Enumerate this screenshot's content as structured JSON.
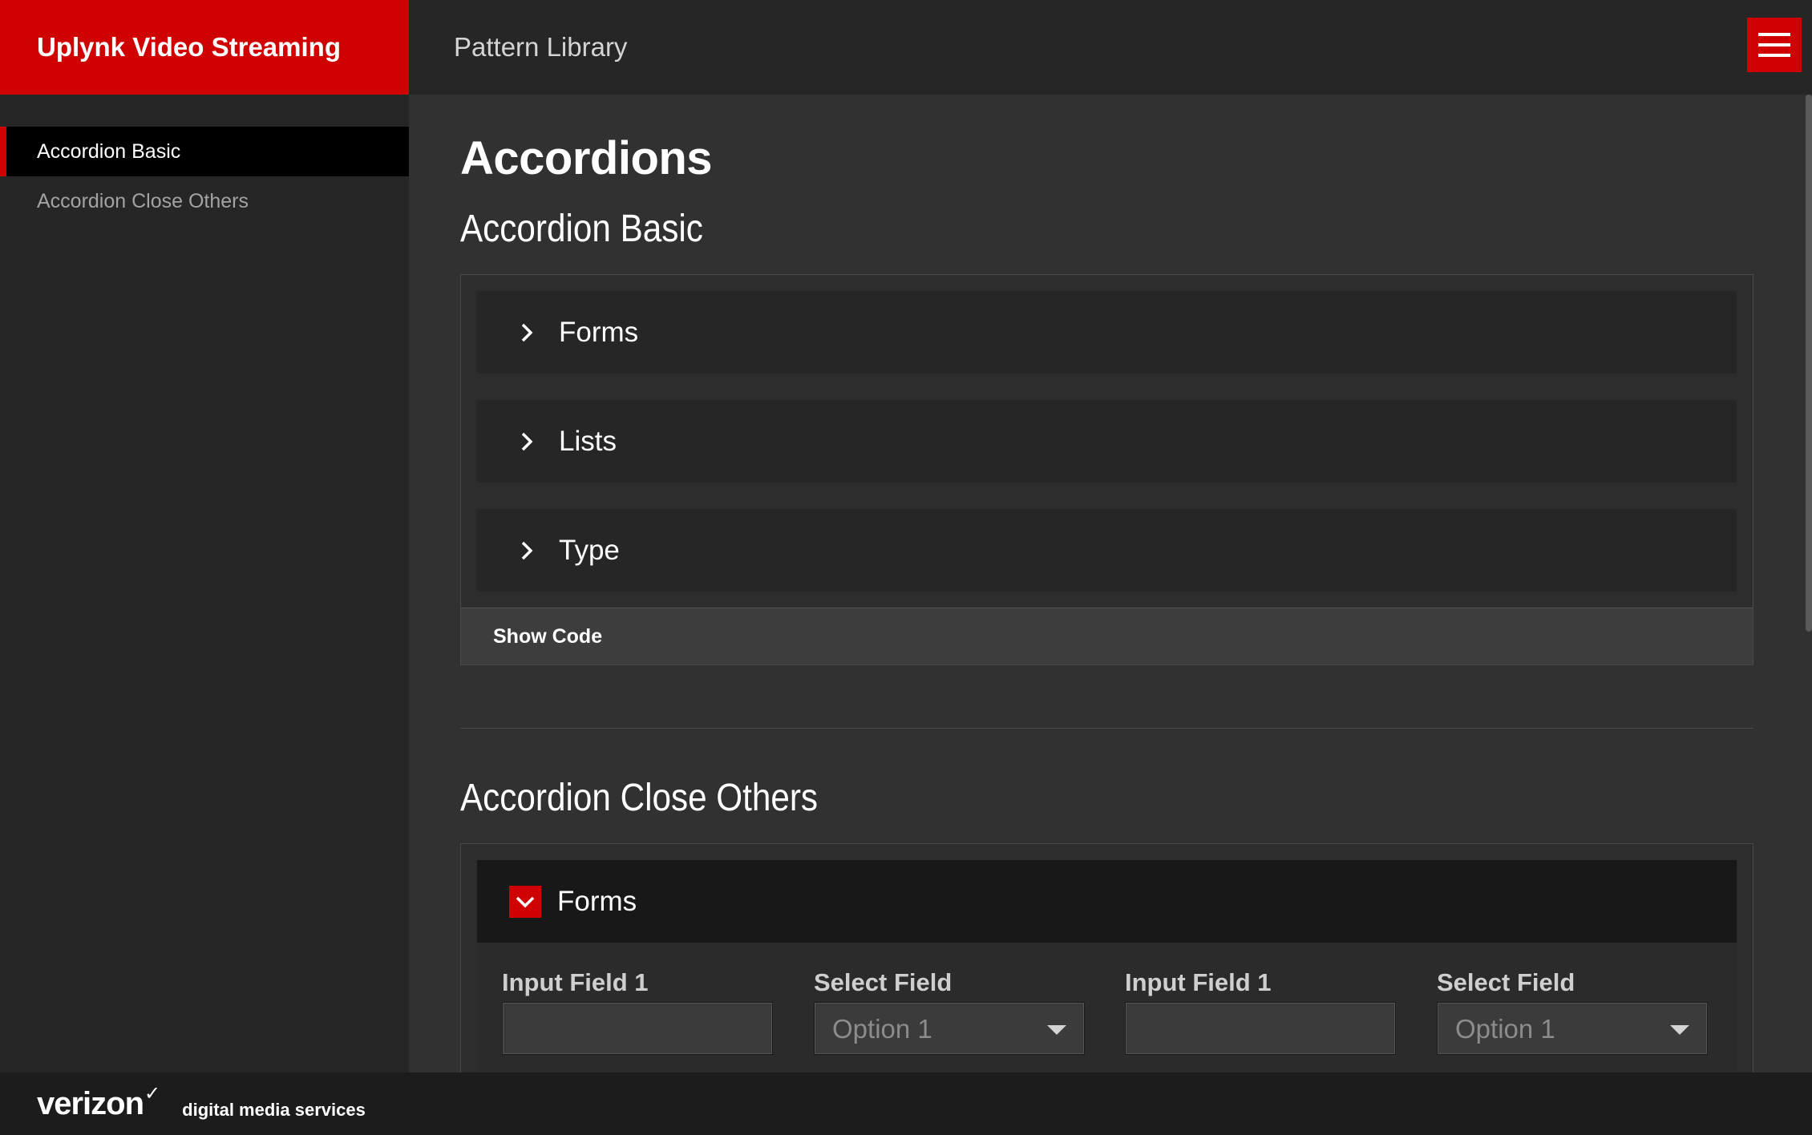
{
  "brand": {
    "title": "Uplynk Video Streaming",
    "color": "#d00101"
  },
  "topbar": {
    "title": "Pattern Library",
    "menu_icon": "hamburger-icon"
  },
  "sidebar": {
    "items": [
      {
        "label": "Accordion Basic",
        "active": true
      },
      {
        "label": "Accordion Close Others",
        "active": false
      }
    ]
  },
  "main": {
    "page_title": "Accordions",
    "basic": {
      "title": "Accordion Basic",
      "panels": [
        {
          "label": "Forms",
          "icon": "chevron-right-icon"
        },
        {
          "label": "Lists",
          "icon": "chevron-right-icon"
        },
        {
          "label": "Type",
          "icon": "chevron-right-icon"
        }
      ],
      "show_code": "Show Code"
    },
    "close_others": {
      "title": "Accordion Close Others",
      "open_panel": {
        "label": "Forms",
        "icon": "chevron-down-icon"
      },
      "fields": [
        {
          "label": "Input Field 1",
          "type": "input",
          "value": ""
        },
        {
          "label": "Select Field",
          "type": "select",
          "value": "Option 1"
        },
        {
          "label": "Input Field 1",
          "type": "input",
          "value": ""
        },
        {
          "label": "Select Field",
          "type": "select",
          "value": "Option 1"
        }
      ]
    }
  },
  "footer": {
    "logo": "verizon",
    "logo_mark": "✓",
    "tagline": "digital media services"
  }
}
